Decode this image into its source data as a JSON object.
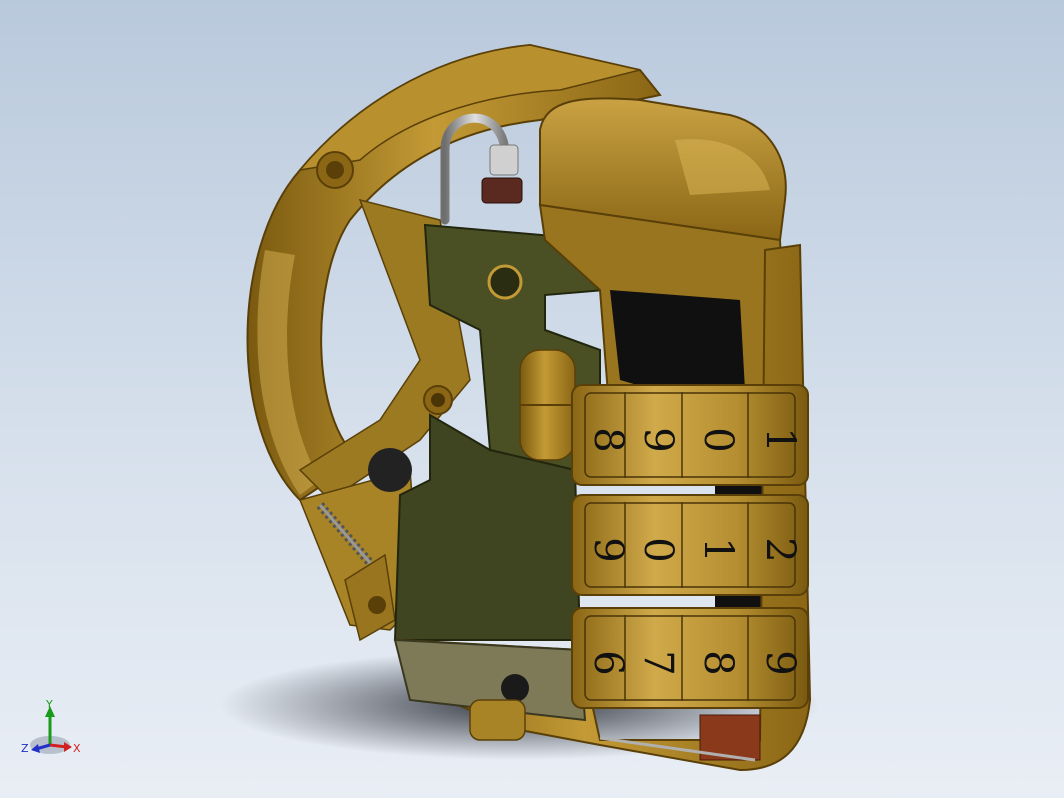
{
  "viewport": {
    "background_top": "#b9c9dc",
    "background_bottom": "#e9eef5"
  },
  "model": {
    "body_color": "#b08a2a",
    "body_shadow": "#7a5a10",
    "plate_color": "#444a22",
    "cavity_color": "#101010",
    "dials": [
      {
        "digits": [
          "8",
          "9",
          "0",
          "1"
        ]
      },
      {
        "digits": [
          "9",
          "0",
          "1",
          "2"
        ]
      },
      {
        "digits": [
          "6",
          "7",
          "8",
          "9"
        ]
      }
    ]
  },
  "triad": {
    "x_label": "X",
    "y_label": "Y",
    "z_label": "Z",
    "x_color": "#d22020",
    "y_color": "#1a9a1a",
    "z_color": "#2030c8"
  }
}
